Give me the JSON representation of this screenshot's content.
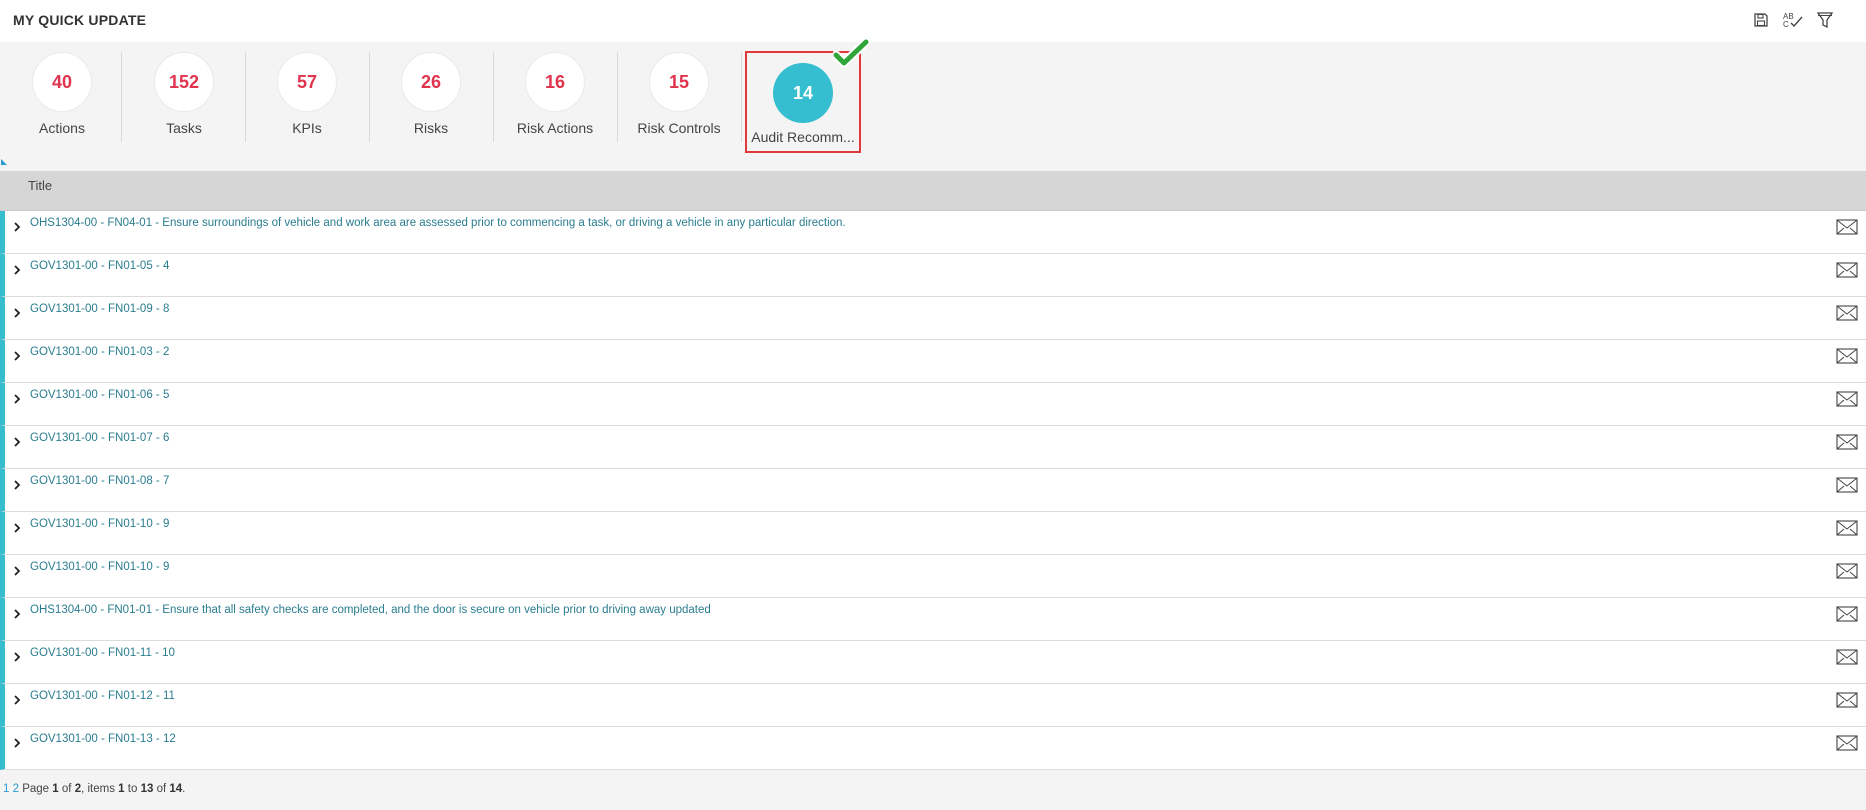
{
  "header": {
    "title": "MY QUICK UPDATE",
    "tools": [
      {
        "icon": "save-icon"
      },
      {
        "icon": "spellcheck-icon",
        "text": "AB"
      },
      {
        "icon": "filter-icon"
      }
    ]
  },
  "tiles": [
    {
      "count": "40",
      "label": "Actions"
    },
    {
      "count": "152",
      "label": "Tasks"
    },
    {
      "count": "57",
      "label": "KPIs"
    },
    {
      "count": "26",
      "label": "Risks"
    },
    {
      "count": "16",
      "label": "Risk Actions"
    },
    {
      "count": "15",
      "label": "Risk Controls"
    },
    {
      "count": "14",
      "label": "Audit Recomm...",
      "active": true
    }
  ],
  "grid": {
    "column_title": "Title",
    "rows": [
      "OHS1304-00 - FN04-01 - Ensure surroundings of vehicle and work area are assessed prior to commencing a task, or driving a vehicle in any particular direction.",
      "GOV1301-00 - FN01-05 - 4",
      "GOV1301-00 - FN01-09 - 8",
      "GOV1301-00 - FN01-03 - 2",
      "GOV1301-00 - FN01-06 - 5",
      "GOV1301-00 - FN01-07 - 6",
      "GOV1301-00 - FN01-08 - 7",
      "GOV1301-00 - FN01-10 - 9",
      "GOV1301-00 - FN01-10 - 9",
      "OHS1304-00 - FN01-01 - Ensure that all safety checks are completed, and the door is secure on vehicle prior to driving away updated",
      "GOV1301-00 - FN01-11 - 10",
      "GOV1301-00 - FN01-12 - 11",
      "GOV1301-00 - FN01-13 - 12"
    ]
  },
  "pager": {
    "page1": "1",
    "page2": "2",
    "page_word": "Page",
    "current": "1",
    "of_word": "of",
    "total_pages": "2",
    "items_word": ", items",
    "from": "1",
    "to_word": "to",
    "to": "13",
    "of_items_word": "of",
    "total_items": "14",
    "end": "."
  },
  "colors": {
    "accent": "#35bdd0",
    "count_red": "#e0334d",
    "active_border": "#e0393b",
    "link": "#2a7d8f",
    "check_green": "#2fa53a"
  }
}
